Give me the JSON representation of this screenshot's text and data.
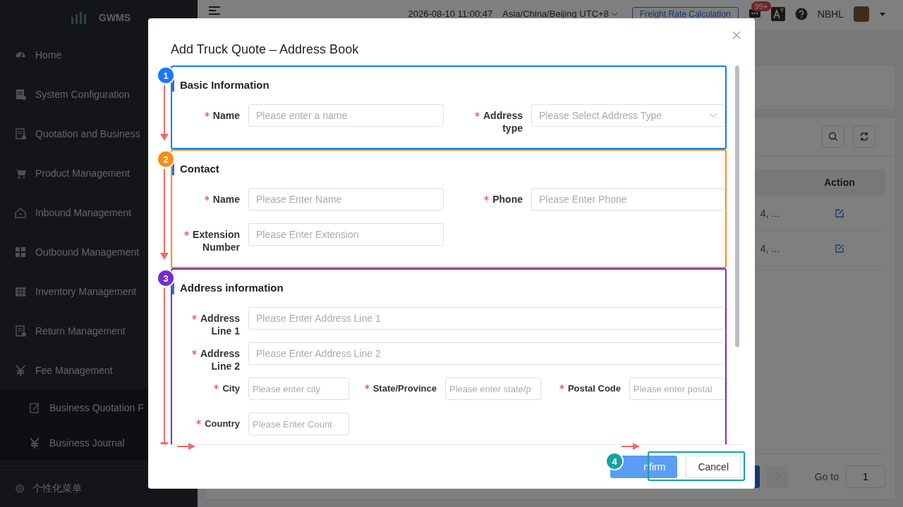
{
  "sidebar": {
    "logo": "GWMS",
    "items": [
      {
        "label": "Home"
      },
      {
        "label": "System Configuration"
      },
      {
        "label": "Quotation and Business"
      },
      {
        "label": "Product Management"
      },
      {
        "label": "Inbound Management"
      },
      {
        "label": "Outbound Management"
      },
      {
        "label": "Inventory Management"
      },
      {
        "label": "Return Management"
      },
      {
        "label": "Fee Management",
        "children": [
          {
            "label": "Business Quotation F"
          },
          {
            "label": "Business Journal"
          }
        ]
      }
    ],
    "footer": "个性化菜单"
  },
  "header": {
    "datetime": "2026-08-10 11:00:47",
    "timezone": "Asia/China/Beijing UTC+8",
    "freight_button": "Freight Rate Calculation",
    "notification_badge": "99+",
    "user": "NBHL"
  },
  "table": {
    "columns": [
      "Action"
    ],
    "rows": [
      {
        "cell": "4, ..."
      },
      {
        "cell": "4, ..."
      }
    ]
  },
  "pagination": {
    "goto_label": "Go to",
    "page_input": "1"
  },
  "dialog": {
    "title": "Add Truck Quote – Address Book",
    "sections": [
      {
        "title": "Basic Information",
        "badge": "1",
        "color": "#1677ff",
        "rows": [
          {
            "kind": "pair",
            "fields": [
              {
                "label": "Name",
                "required": true,
                "placeholder": "Please enter a name",
                "kind": "input"
              },
              {
                "label": "Address type",
                "required": true,
                "placeholder": "Please Select Address Type",
                "kind": "select"
              }
            ]
          }
        ]
      },
      {
        "title": "Contact",
        "badge": "2",
        "color": "#fa8c16",
        "rows": [
          {
            "kind": "pair",
            "fields": [
              {
                "label": "Name",
                "required": true,
                "placeholder": "Please Enter Name",
                "kind": "input"
              },
              {
                "label": "Phone",
                "required": true,
                "placeholder": "Please Enter Phone",
                "kind": "input"
              }
            ]
          },
          {
            "kind": "pair",
            "fields": [
              {
                "label": "Extension Number",
                "required": true,
                "placeholder": "Please Enter Extension",
                "kind": "input"
              }
            ]
          }
        ]
      },
      {
        "title": "Address information",
        "badge": "3",
        "color": "#722ed1",
        "rows": [
          {
            "kind": "full",
            "fields": [
              {
                "label": "Address Line 1",
                "required": true,
                "placeholder": "Please Enter Address Line 1",
                "kind": "input"
              }
            ]
          },
          {
            "kind": "full",
            "fields": [
              {
                "label": "Address Line 2",
                "required": true,
                "placeholder": "Please Enter Address Line 2",
                "kind": "input"
              }
            ]
          },
          {
            "kind": "triple",
            "fields": [
              {
                "label": "City",
                "required": true,
                "placeholder": "Please enter city",
                "kind": "input"
              },
              {
                "label": "State/Province",
                "required": true,
                "placeholder": "Please enter state/p",
                "kind": "input"
              },
              {
                "label": "Postal Code",
                "required": true,
                "placeholder": "Please enter postal",
                "kind": "input"
              }
            ]
          },
          {
            "kind": "triple",
            "fields": [
              {
                "label": "Country",
                "required": true,
                "placeholder": "Please Enter Count",
                "kind": "input"
              }
            ]
          }
        ]
      }
    ],
    "footer": {
      "badge": "4",
      "color": "#13a3a3",
      "buttons": [
        {
          "label": "nfirm",
          "kind": "primary"
        },
        {
          "label": "Cancel",
          "kind": "default"
        }
      ]
    }
  }
}
